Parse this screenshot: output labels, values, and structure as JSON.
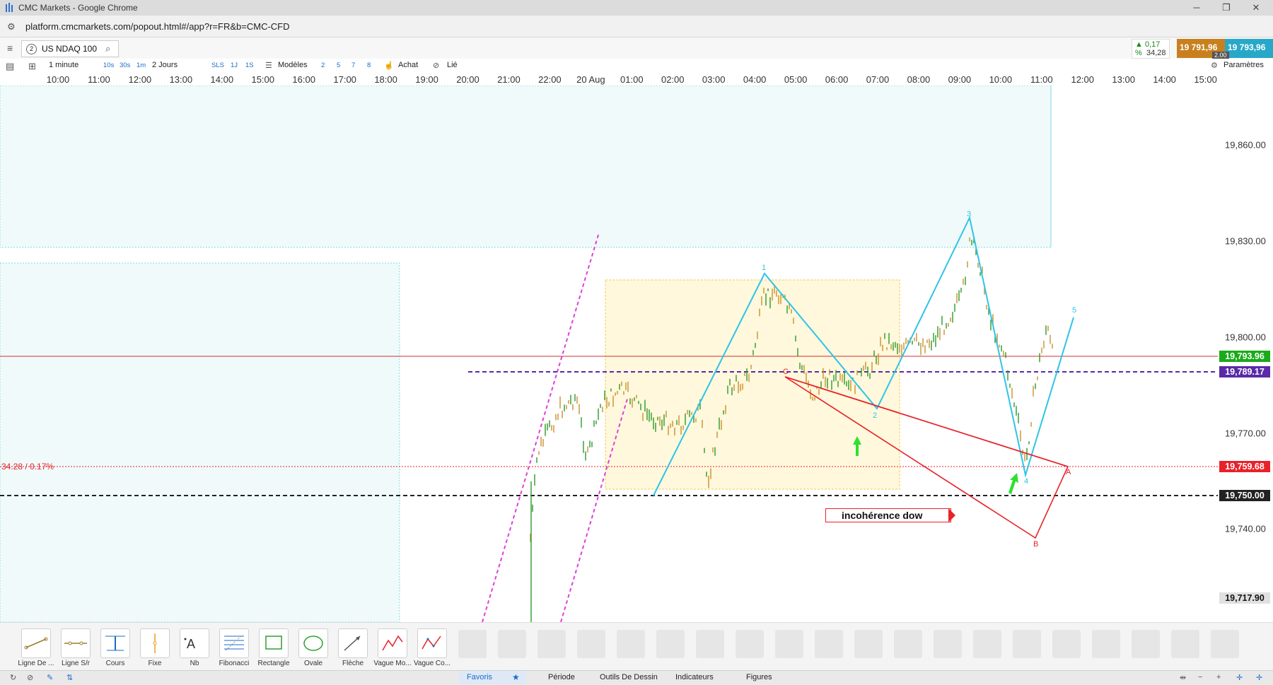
{
  "window": {
    "title": "CMC Markets - Google Chrome",
    "url": "platform.cmcmarkets.com/popout.html#/app?r=FR&b=CMC-CFD"
  },
  "instrument": {
    "tab_number": "2",
    "name": "US NDAQ 100",
    "change_pct": "▲ 0,17 %",
    "change_pts": "34,28",
    "sell_price": "19 791,96",
    "buy_price": "19 793,96",
    "spread": "2.00"
  },
  "toolbar": {
    "interval": "1 minute",
    "interval_buttons": [
      "10s",
      "30s",
      "1m"
    ],
    "period": "2 Jours",
    "period_buttons": [
      "SLS",
      "1J",
      "1S"
    ],
    "models_label": "Modèles",
    "model_buttons": [
      "2",
      "5",
      "7",
      "8"
    ],
    "buy_label": "Achat",
    "link_label": "Lié",
    "settings_label": "Paramètres"
  },
  "time_axis": [
    "10:00",
    "11:00",
    "12:00",
    "13:00",
    "14:00",
    "15:00",
    "16:00",
    "17:00",
    "18:00",
    "19:00",
    "20:00",
    "21:00",
    "22:00",
    "20 Aug",
    "01:00",
    "02:00",
    "03:00",
    "04:00",
    "05:00",
    "06:00",
    "07:00",
    "08:00",
    "09:00",
    "10:00",
    "11:00",
    "12:00",
    "13:00",
    "14:00",
    "15:00"
  ],
  "price_axis": [
    "19,860.00",
    "19,830.00",
    "19,800.00",
    "19,770.00",
    "19,740.00"
  ],
  "price_tags": {
    "current": {
      "label": "19,793.96",
      "color": "#1aaa1a"
    },
    "purple": {
      "label": "19,789.17",
      "color": "#5a2aa8"
    },
    "red": {
      "label": "19,759.68",
      "color": "#e8222a"
    },
    "level": {
      "label": "19,750.00",
      "color": "#222222"
    },
    "bottom": {
      "label": "19,717.90",
      "color": "#444444"
    }
  },
  "chart": {
    "change_annotation": "34.28 / 0.17%",
    "note_text": "incohérence dow",
    "wave_labels": [
      "1",
      "2",
      "3",
      "4",
      "5"
    ],
    "corrective_labels": [
      "A",
      "B",
      "C"
    ],
    "colors": {
      "wave": "#2ec4e6",
      "corrective": "#e8222a",
      "channel": "#e040d8",
      "box": "#fff8dc"
    }
  },
  "tools": [
    {
      "label": "Ligne De ...",
      "icon": "trend-line-icon"
    },
    {
      "label": "Ligne S/r",
      "icon": "sr-line-icon"
    },
    {
      "label": "Cours",
      "icon": "price-line-icon"
    },
    {
      "label": "Fixe",
      "icon": "vertical-line-icon"
    },
    {
      "label": "Nb",
      "icon": "text-icon"
    },
    {
      "label": "Fibonacci",
      "icon": "fibonacci-icon"
    },
    {
      "label": "Rectangle",
      "icon": "rectangle-icon"
    },
    {
      "label": "Ovale",
      "icon": "oval-icon"
    },
    {
      "label": "Flèche",
      "icon": "arrow-icon"
    },
    {
      "label": "Vague Mo...",
      "icon": "wave-motive-icon"
    },
    {
      "label": "Vague Co...",
      "icon": "wave-corrective-icon"
    }
  ],
  "bottom_tabs": [
    "Favoris",
    "Période",
    "Outils De Dessin",
    "Indicateurs",
    "Figures"
  ]
}
